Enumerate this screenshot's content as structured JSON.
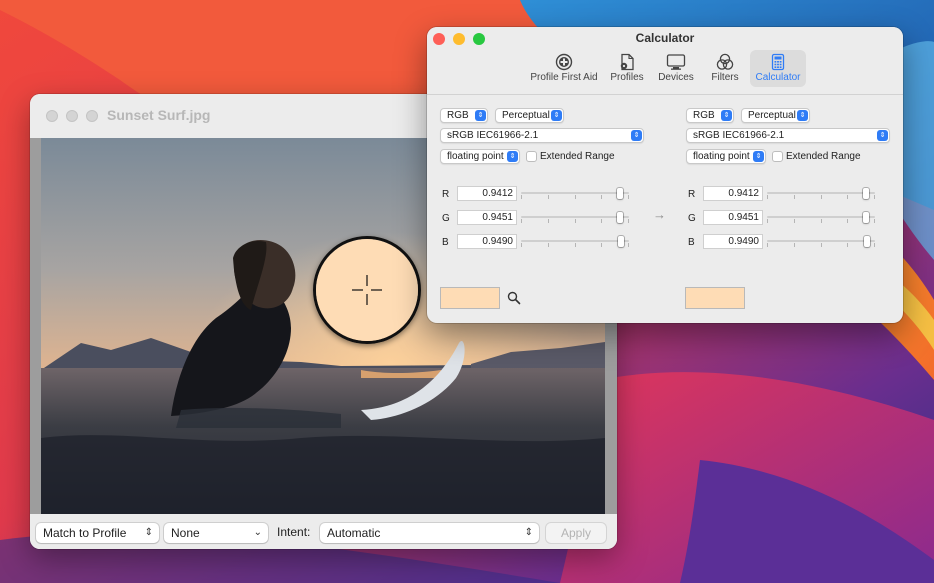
{
  "image_window": {
    "title": "Sunset Surf.jpg",
    "bottom_bar": {
      "match_popup": "Match to Profile",
      "profile_popup": "None",
      "intent_label": "Intent:",
      "intent_popup": "Automatic",
      "apply_label": "Apply"
    }
  },
  "calculator": {
    "title": "Calculator",
    "toolbar": [
      {
        "label": "Profile First Aid",
        "icon": "plus-circle-icon"
      },
      {
        "label": "Profiles",
        "icon": "document-gear-icon"
      },
      {
        "label": "Devices",
        "icon": "display-icon"
      },
      {
        "label": "Filters",
        "icon": "color-circles-icon"
      },
      {
        "label": "Calculator",
        "icon": "calculator-icon",
        "selected": true
      }
    ],
    "left": {
      "color_model": "RGB",
      "intent": "Perceptual",
      "profile": "sRGB IEC61966-2.1",
      "format": "floating point",
      "extended_range_label": "Extended Range",
      "extended_range_checked": false,
      "channels": [
        {
          "label": "R",
          "value": "0.9412",
          "level": 0.9412
        },
        {
          "label": "G",
          "value": "0.9451",
          "level": 0.9451
        },
        {
          "label": "B",
          "value": "0.9490",
          "level": 0.949
        }
      ],
      "swatch_color": "#fedcb5"
    },
    "arrow": "→",
    "right": {
      "color_model": "RGB",
      "intent": "Perceptual",
      "profile": "sRGB IEC61966-2.1",
      "format": "floating point",
      "extended_range_label": "Extended Range",
      "extended_range_checked": false,
      "channels": [
        {
          "label": "R",
          "value": "0.9412",
          "level": 0.9412
        },
        {
          "label": "G",
          "value": "0.9451",
          "level": 0.9451
        },
        {
          "label": "B",
          "value": "0.9490",
          "level": 0.949
        }
      ],
      "swatch_color": "#fedcb5"
    }
  },
  "magnifier": {
    "sample_color": "#fedcb5"
  },
  "colors": {
    "accent": "#2f7cf6",
    "close": "#fe5f57",
    "minimize": "#febc2e",
    "zoom": "#28c840"
  }
}
